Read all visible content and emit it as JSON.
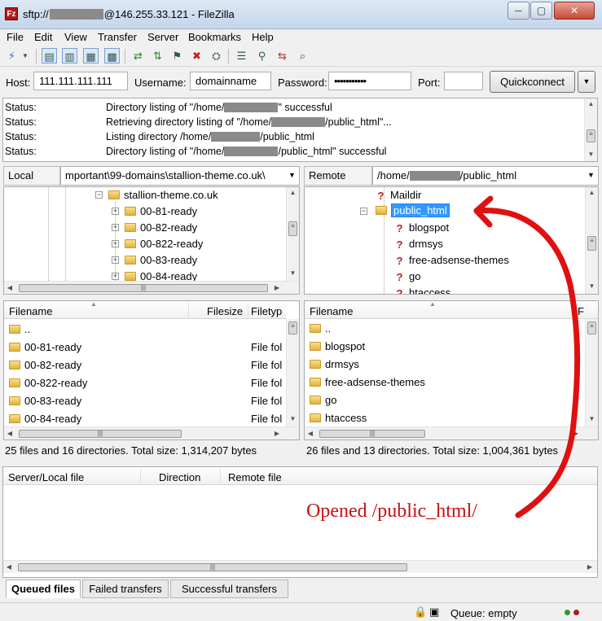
{
  "window": {
    "title_prefix": "sftp://",
    "title_suffix": "@146.255.33.121 - FileZilla",
    "app_icon": "Fz",
    "minimize": "─",
    "maximize": "▢",
    "close": "✕"
  },
  "menu": [
    "File",
    "Edit",
    "View",
    "Transfer",
    "Server",
    "Bookmarks",
    "Help"
  ],
  "toolbar_icons": [
    "site-manager-icon",
    "dropdown-arrow-icon",
    "toggle-log-icon",
    "toggle-local-tree-icon",
    "toggle-remote-tree-icon",
    "toggle-queue-icon",
    "refresh-icon",
    "process-queue-icon",
    "cancel-icon",
    "disconnect-icon",
    "reconnect-icon",
    "directory-filter-icon",
    "sync-browse-icon",
    "compare-icon",
    "search-icon"
  ],
  "quickconnect": {
    "host_label": "Host:",
    "host_value": "111.111.111.111",
    "username_label": "Username:",
    "username_value": "domainname",
    "password_label": "Password:",
    "password_value": "•••••••••••",
    "port_label": "Port:",
    "port_value": "",
    "button": "Quickconnect",
    "dropdown": "▼"
  },
  "log": [
    {
      "k": "Status:",
      "pre": "Directory listing of \"/home/",
      "post": "\" successful"
    },
    {
      "k": "Status:",
      "pre": "Retrieving directory listing of \"/home/",
      "post": "/public_html\"..."
    },
    {
      "k": "Status:",
      "pre": "Listing directory /home/",
      "post": "/public_html"
    },
    {
      "k": "Status:",
      "pre": "Directory listing of \"/home/",
      "post": "/public_html\" successful"
    }
  ],
  "local": {
    "site_label": "Local site:",
    "site_path": "mportant\\99-domains\\stallion-theme.co.uk\\",
    "tree_root": "stallion-theme.co.uk",
    "tree_children": [
      "00-81-ready",
      "00-82-ready",
      "00-822-ready",
      "00-83-ready",
      "00-84-ready"
    ],
    "col_filename": "Filename",
    "col_filesize": "Filesize",
    "col_filetype": "Filetyp",
    "files": [
      {
        "name": "..",
        "type": ""
      },
      {
        "name": "00-81-ready",
        "type": "File fol"
      },
      {
        "name": "00-82-ready",
        "type": "File fol"
      },
      {
        "name": "00-822-ready",
        "type": "File fol"
      },
      {
        "name": "00-83-ready",
        "type": "File fol"
      },
      {
        "name": "00-84-ready",
        "type": "File fol"
      }
    ],
    "status": "25 files and 16 directories. Total size: 1,314,207 bytes"
  },
  "remote": {
    "site_label": "Remote site:",
    "site_path_pre": "/home/",
    "site_path_post": "/public_html",
    "tree": [
      {
        "name": "Maildir",
        "icon": "question-icon"
      },
      {
        "name": "public_html",
        "icon": "folder-icon",
        "selected": true
      },
      {
        "name": "blogspot",
        "icon": "question-icon"
      },
      {
        "name": "drmsys",
        "icon": "question-icon"
      },
      {
        "name": "free-adsense-themes",
        "icon": "question-icon"
      },
      {
        "name": "go",
        "icon": "question-icon"
      },
      {
        "name": "htaccess",
        "icon": "question-icon"
      }
    ],
    "col_filename": "Filename",
    "col_f": "F",
    "files": [
      "..",
      "blogspot",
      "drmsys",
      "free-adsense-themes",
      "go",
      "htaccess"
    ],
    "status": "26 files and 13 directories. Total size: 1,004,361 bytes"
  },
  "queue": {
    "col_file": "Server/Local file",
    "col_direction": "Direction",
    "col_remote": "Remote file"
  },
  "tabs": [
    "Queued files",
    "Failed transfers",
    "Successful transfers"
  ],
  "statusbar": {
    "queue": "Queue: empty"
  },
  "annotation": {
    "text": "Opened /public_html/",
    "color": "#c81010"
  }
}
